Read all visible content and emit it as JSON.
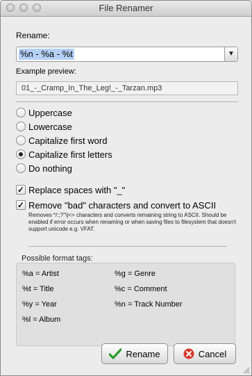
{
  "window": {
    "title": "File Renamer"
  },
  "rename": {
    "label": "Rename:",
    "value": "%n - %a - %t"
  },
  "preview": {
    "label": "Example preview:",
    "value": "01_-_Cramp_In_The_Leg!_-_Tarzan.mp3"
  },
  "case_options": [
    {
      "label": "Uppercase",
      "selected": false
    },
    {
      "label": "Lowercase",
      "selected": false
    },
    {
      "label": "Capitalize first word",
      "selected": false
    },
    {
      "label": "Capitalize first letters",
      "selected": true
    },
    {
      "label": "Do nothing",
      "selected": false
    }
  ],
  "options": {
    "replace_spaces": {
      "label": "Replace spaces with \"_\"",
      "checked": true
    },
    "remove_bad": {
      "label": "Remove \"bad\" characters and convert to ASCII",
      "checked": true,
      "description": "Removes */:;?\"\\|<> characters and converts remaining string to ASCII. Should be enabled if error occurs when renaming or when saving files to filesystem that doesn't support unicode e.g. VFAT."
    }
  },
  "format_tags": {
    "header": "Possible format tags:",
    "items": [
      "%a = Artist",
      "%g = Genre",
      "%t = Title",
      "%c = Comment",
      "%y = Year",
      "%n = Track Number",
      "%l = Album"
    ]
  },
  "buttons": {
    "rename": "Rename",
    "cancel": "Cancel"
  },
  "colors": {
    "selection": "#b5d0f5",
    "ok_green": "#2a9a2a",
    "cancel_red": "#d63a2e"
  }
}
